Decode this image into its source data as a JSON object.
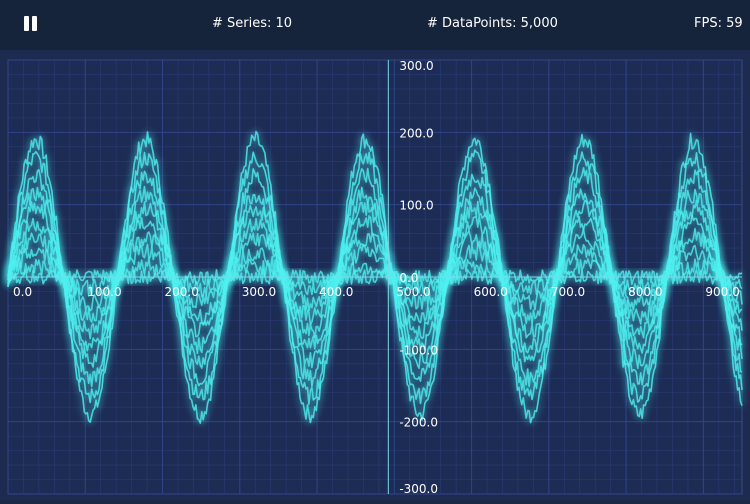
{
  "toolbar": {
    "pause_icon": "pause-icon",
    "series_label": "# Series:",
    "series_value": "10",
    "datapoints_label": "# DataPoints:",
    "datapoints_value": "5,000",
    "fps_label": "FPS:",
    "fps_value": "59"
  },
  "chart_data": {
    "type": "line",
    "xlim": [
      0,
      950
    ],
    "ylim": [
      -300,
      300
    ],
    "x_ticks": [
      "0.0",
      "100.0",
      "200.0",
      "300.0",
      "400.0",
      "500.0",
      "600.0",
      "700.0",
      "800.0",
      "900.0"
    ],
    "x_tick_values": [
      0,
      100,
      200,
      300,
      400,
      500,
      600,
      700,
      800,
      900
    ],
    "y_ticks": [
      "300.0",
      "200.0",
      "100.0",
      "0.0",
      "-100.0",
      "-200.0",
      "-300.0"
    ],
    "y_tick_values": [
      300,
      200,
      100,
      0,
      -100,
      -200,
      -300
    ],
    "y_axis_at_x": 500,
    "grid": true,
    "line_color": "#4ff0f0",
    "background_color": "#1c2b4f",
    "grid_color": "#34468f",
    "series": [
      {
        "amplitude": 190,
        "period": 142,
        "noise": 12
      },
      {
        "amplitude": 165,
        "period": 142,
        "noise": 12
      },
      {
        "amplitude": 140,
        "period": 142,
        "noise": 12
      },
      {
        "amplitude": 115,
        "period": 142,
        "noise": 12
      },
      {
        "amplitude": 95,
        "period": 142,
        "noise": 12
      },
      {
        "amplitude": 75,
        "period": 142,
        "noise": 12
      },
      {
        "amplitude": 55,
        "period": 142,
        "noise": 12
      },
      {
        "amplitude": 35,
        "period": 142,
        "noise": 12
      },
      {
        "amplitude": 15,
        "period": 142,
        "noise": 12
      },
      {
        "amplitude": 0,
        "period": 142,
        "noise": 10
      }
    ]
  }
}
